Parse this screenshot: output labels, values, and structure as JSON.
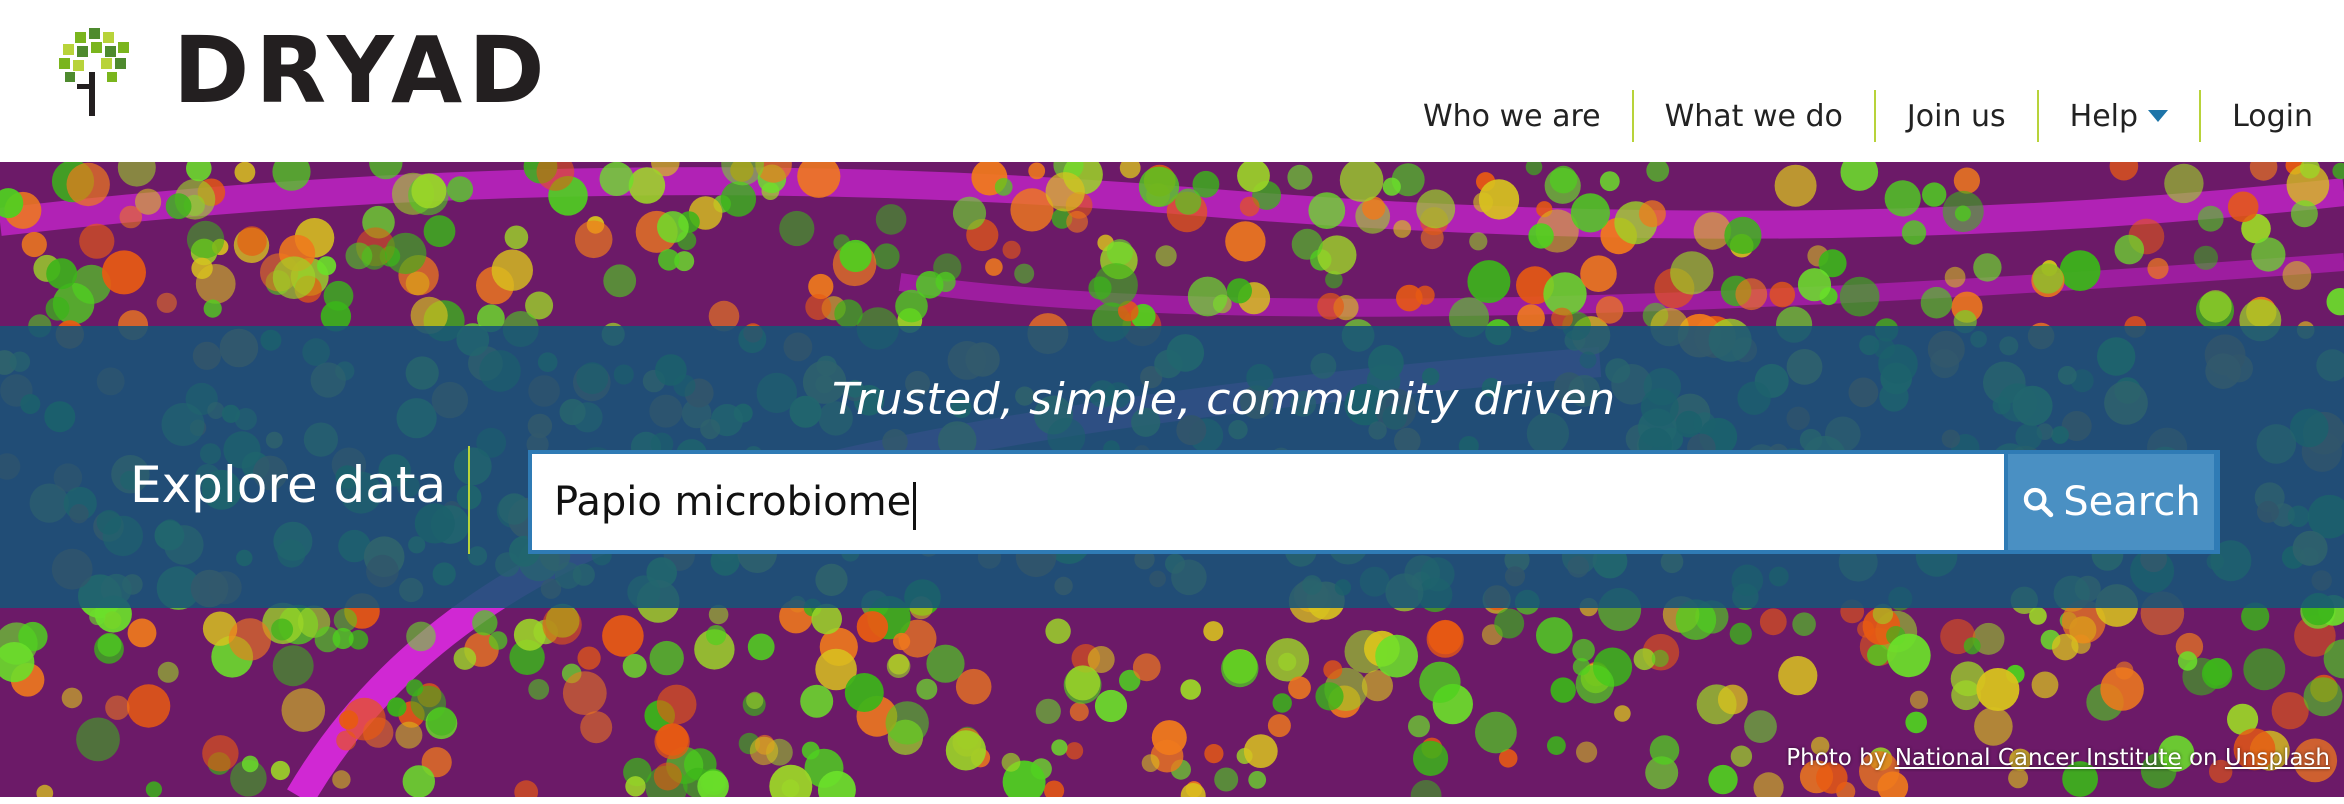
{
  "brand": {
    "name": "DRYAD",
    "colors": {
      "green": "#7ab51d",
      "lime": "#b8d33a",
      "dark": "#231f20"
    }
  },
  "nav": {
    "items": [
      {
        "label": "Who we are"
      },
      {
        "label": "What we do"
      },
      {
        "label": "Join us"
      },
      {
        "label": "Help",
        "has_dropdown": true
      },
      {
        "label": "Login"
      }
    ]
  },
  "hero": {
    "tagline": "Trusted, simple, community driven",
    "explore_label": "Explore data",
    "search": {
      "value": "Papio microbiome",
      "button_label": "Search",
      "icon": "search-icon"
    },
    "credit": {
      "prefix": "Photo by",
      "author": "National Cancer Institute",
      "joiner": "on",
      "source": "Unsplash"
    },
    "colors": {
      "band": "#175478",
      "button": "#4a90c3",
      "border": "#2f7bb5"
    }
  }
}
